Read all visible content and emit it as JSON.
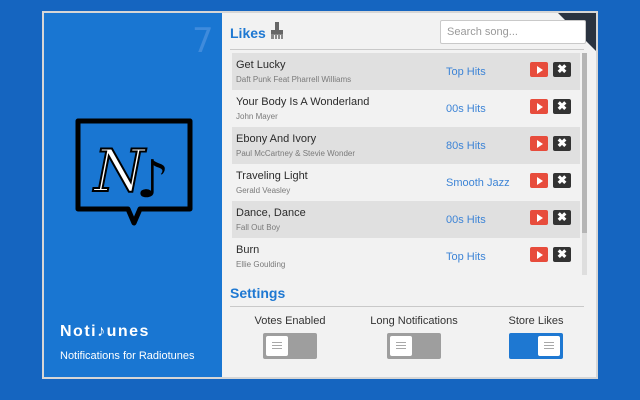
{
  "sidebar": {
    "ghost_number": "7",
    "app_name": "Noti♪unes",
    "tagline": "Notifications for Radiotunes",
    "logo_letter": "N",
    "logo_note": "♪"
  },
  "likes": {
    "title": "Likes",
    "clear_icon": "broom-icon",
    "search_placeholder": "Search song...",
    "songs": [
      {
        "title": "Get Lucky",
        "artist": "Daft Punk Feat Pharrell Williams",
        "station": "Top Hits"
      },
      {
        "title": "Your Body Is A Wonderland",
        "artist": "John Mayer",
        "station": "00s Hits"
      },
      {
        "title": "Ebony And Ivory",
        "artist": "Paul McCartney & Stevie Wonder",
        "station": "80s Hits"
      },
      {
        "title": "Traveling Light",
        "artist": "Gerald Veasley",
        "station": "Smooth Jazz"
      },
      {
        "title": "Dance, Dance",
        "artist": "Fall Out Boy",
        "station": "00s Hits"
      },
      {
        "title": "Burn",
        "artist": "Ellie Goulding",
        "station": "Top Hits"
      }
    ],
    "delete_glyph": "✖"
  },
  "settings": {
    "title": "Settings",
    "toggles": [
      {
        "label": "Votes Enabled",
        "state": "off"
      },
      {
        "label": "Long Notifications",
        "state": "off"
      },
      {
        "label": "Store Likes",
        "state": "on"
      }
    ]
  },
  "colors": {
    "accent": "#1976d2",
    "play": "#e74c3c",
    "delete": "#333333",
    "station_link": "#3d84d6"
  }
}
